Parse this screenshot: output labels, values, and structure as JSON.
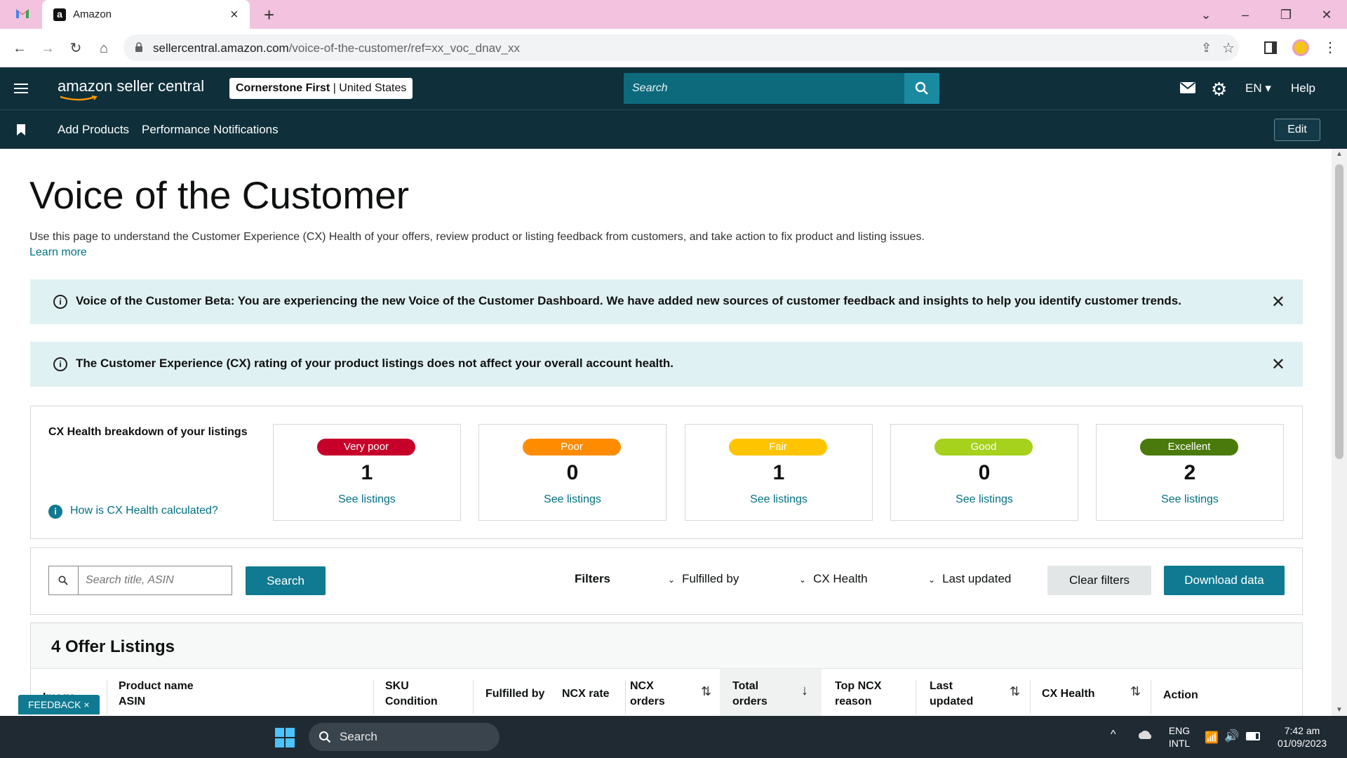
{
  "browser": {
    "tab_title": "Amazon",
    "tab_favicon": "a",
    "url_host": "sellercentral.amazon.com",
    "url_path": "/voice-of-the-customer/ref=xx_voc_dnav_xx"
  },
  "header": {
    "logo_text": "amazon seller central",
    "store_name": "Cornerstone First",
    "store_region": "United States",
    "search_placeholder": "Search",
    "language": "EN",
    "help": "Help"
  },
  "subnav": {
    "items": [
      "Add Products",
      "Performance Notifications"
    ],
    "edit_label": "Edit"
  },
  "page": {
    "title": "Voice of the Customer",
    "description": "Use this page to understand the Customer Experience (CX) Health of your offers, review product or listing feedback from customers, and take action to fix product and listing issues.",
    "learn_more": "Learn more"
  },
  "banners": [
    {
      "text": "Voice of the Customer Beta: You are experiencing the new Voice of the Customer Dashboard. We have added new sources of customer feedback and insights to help you identify customer trends."
    },
    {
      "text": "The Customer Experience (CX) rating of your product listings does not affect your overall account health."
    }
  ],
  "cx_health": {
    "heading": "CX Health breakdown of your listings",
    "help_link": "How is CX Health calculated?",
    "cards": [
      {
        "label": "Very poor",
        "count": "1",
        "link": "See listings",
        "color": "#c7002a"
      },
      {
        "label": "Poor",
        "count": "0",
        "link": "See listings",
        "color": "#ff8c00"
      },
      {
        "label": "Fair",
        "count": "1",
        "link": "See listings",
        "color": "#ffc400"
      },
      {
        "label": "Good",
        "count": "0",
        "link": "See listings",
        "color": "#a6d11c"
      },
      {
        "label": "Excellent",
        "count": "2",
        "link": "See listings",
        "color": "#4a7a0b"
      }
    ]
  },
  "filters": {
    "search_placeholder": "Search title, ASIN",
    "search_button": "Search",
    "label": "Filters",
    "dropdowns": [
      "Fulfilled by",
      "CX Health",
      "Last updated"
    ],
    "clear_button": "Clear filters",
    "download_button": "Download data"
  },
  "listings": {
    "heading": "4 Offer Listings",
    "columns": [
      [
        "Image"
      ],
      [
        "Product name",
        "ASIN"
      ],
      [
        "SKU",
        "Condition"
      ],
      [
        "Fulfilled by"
      ],
      [
        "NCX rate"
      ],
      [
        "NCX",
        "orders"
      ],
      [
        "Total",
        "orders"
      ],
      [
        "Top NCX",
        "reason"
      ],
      [
        "Last",
        "updated"
      ],
      [
        "CX Health"
      ],
      [
        "Action"
      ]
    ]
  },
  "feedback_tab": "FEEDBACK ×",
  "taskbar": {
    "search": "Search",
    "lang_top": "ENG",
    "lang_bottom": "INTL",
    "time": "7:42 am",
    "date": "01/09/2023"
  }
}
